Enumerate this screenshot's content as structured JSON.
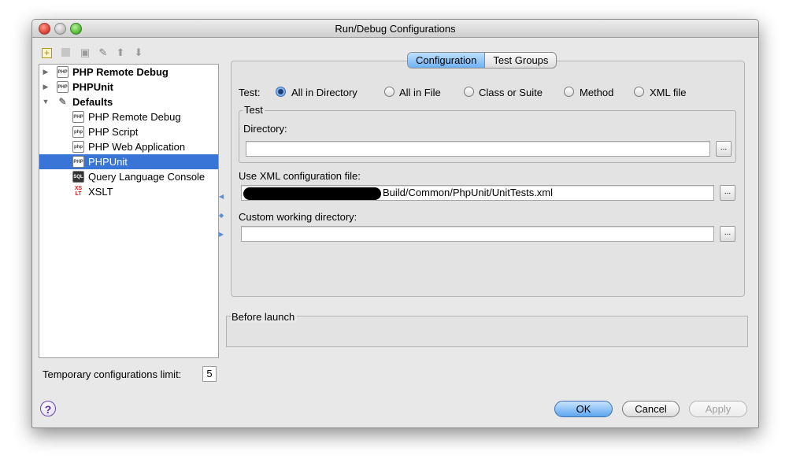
{
  "window": {
    "title": "Run/Debug Configurations"
  },
  "toolbar": {
    "icons": [
      "add-icon",
      "remove-icon",
      "copy-icon",
      "wrench-icon",
      "arrow-up-icon",
      "arrow-down-icon"
    ]
  },
  "tree": {
    "items": [
      {
        "label": "PHP Remote Debug",
        "bold": true,
        "expander": "collapsed"
      },
      {
        "label": "PHPUnit",
        "bold": true,
        "expander": "collapsed"
      },
      {
        "label": "Defaults",
        "bold": true,
        "expander": "expanded"
      },
      {
        "label": "PHP Remote Debug"
      },
      {
        "label": "PHP Script"
      },
      {
        "label": "PHP Web Application"
      },
      {
        "label": "PHPUnit",
        "selected": true
      },
      {
        "label": "Query Language Console"
      },
      {
        "label": "XSLT"
      }
    ]
  },
  "tabs": {
    "configuration": "Configuration",
    "test_groups": "Test Groups"
  },
  "test": {
    "label": "Test:",
    "options": [
      "All in Directory",
      "All in File",
      "Class or Suite",
      "Method",
      "XML file"
    ],
    "selected": "All in Directory"
  },
  "test_group": {
    "title": "Test",
    "directory_label": "Directory:",
    "directory_value": ""
  },
  "xml_config": {
    "label": "Use XML configuration file:",
    "value_suffix": "Build/Common/PhpUnit/UnitTests.xml"
  },
  "working_dir": {
    "label": "Custom working directory:",
    "value": ""
  },
  "browse_label": "...",
  "before_launch": {
    "title": "Before launch"
  },
  "temp_limit": {
    "label": "Temporary configurations limit:",
    "value": "5"
  },
  "buttons": {
    "help": "?",
    "ok": "OK",
    "cancel": "Cancel",
    "apply": "Apply"
  },
  "colors": {
    "selection": "#3875d7",
    "accent": "#5ea5ee"
  }
}
